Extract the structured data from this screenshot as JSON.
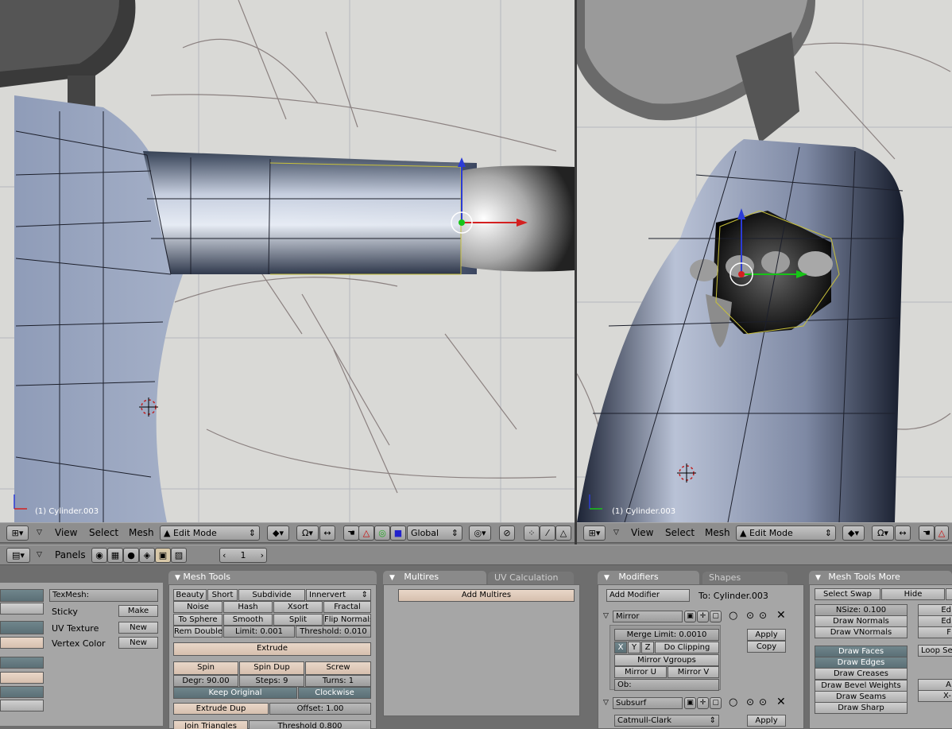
{
  "viewports": {
    "left": {
      "object_label": "(1) Cylinder.003"
    },
    "right": {
      "object_label": "(1) Cylinder.003"
    }
  },
  "header": {
    "view": "View",
    "select": "Select",
    "mesh": "Mesh",
    "mode": "Edit Mode",
    "orientation": "Global"
  },
  "buttons_header": {
    "panels": "Panels",
    "frame": "1"
  },
  "panel_texture": {
    "texmesh": "TexMesh:",
    "sticky": "Sticky",
    "make": "Make",
    "uv_texture": "UV Texture",
    "new1": "New",
    "vertex_color": "Vertex Color",
    "new2": "New"
  },
  "panel_mesh_tools": {
    "title": "Mesh Tools",
    "beauty": "Beauty",
    "short": "Short",
    "subdivide": "Subdivide",
    "innervert": "Innervert",
    "noise": "Noise",
    "hash": "Hash",
    "xsort": "Xsort",
    "fractal": "Fractal",
    "to_sphere": "To Sphere",
    "smooth": "Smooth",
    "split": "Split",
    "flip_normals": "Flip Normals",
    "rem_double": "Rem Double",
    "limit": "Limit: 0.001",
    "threshold": "Threshold: 0.010",
    "extrude": "Extrude",
    "spin": "Spin",
    "spin_dup": "Spin Dup",
    "screw": "Screw",
    "degr": "Degr: 90.00",
    "steps": "Steps: 9",
    "turns": "Turns: 1",
    "keep_original": "Keep Original",
    "clockwise": "Clockwise",
    "extrude_dup": "Extrude Dup",
    "offset": "Offset: 1.00",
    "join_triangles": "Join Triangles",
    "threshold2": "Threshold 0.800"
  },
  "panel_multires": {
    "tab_active": "Multires",
    "tab_inactive": "UV Calculation",
    "add_multires": "Add Multires"
  },
  "panel_modifiers": {
    "tab_active": "Modifiers",
    "tab_inactive": "Shapes",
    "add_modifier": "Add Modifier",
    "to": "To: Cylinder.003",
    "mirror": "Mirror",
    "merge_limit": "Merge Limit: 0.0010",
    "x": "X",
    "y": "Y",
    "z": "Z",
    "do_clipping": "Do Clipping",
    "mirror_vgroups": "Mirror Vgroups",
    "mirror_u": "Mirror U",
    "mirror_v": "Mirror V",
    "ob": "Ob:",
    "apply1": "Apply",
    "copy1": "Copy",
    "subsurf": "Subsurf",
    "catmull": "Catmull-Clark",
    "apply2": "Apply"
  },
  "panel_mesh_tools_more": {
    "title": "Mesh Tools More",
    "select_swap": "Select Swap",
    "hide": "Hide",
    "nsize": "NSize: 0.100",
    "draw_normals": "Draw Normals",
    "draw_vnormals": "Draw VNormals",
    "draw_faces": "Draw Faces",
    "draw_edges": "Draw Edges",
    "draw_creases": "Draw Creases",
    "draw_bevel_weights": "Draw Bevel Weights",
    "draw_seams": "Draw Seams",
    "draw_sharp": "Draw Sharp",
    "loop_sel": "Loop Se",
    "ed1": "Ed",
    "ed2": "Ed",
    "f": "F",
    "a": "A",
    "x_dash": "X-"
  }
}
